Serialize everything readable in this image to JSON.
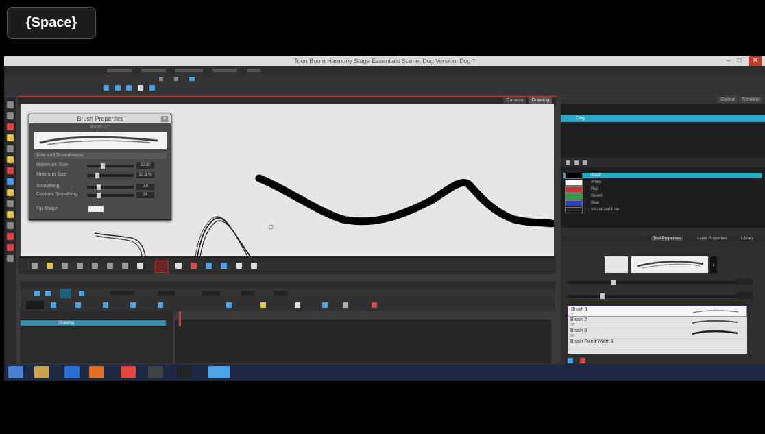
{
  "window": {
    "title": "Toon Boom Harmony Stage Essentials Scene: Dog Version: Dog *",
    "controls": {
      "minimize": "–",
      "maximize": "□",
      "close": "✕"
    }
  },
  "overlay": {
    "key_badge": "{Space}"
  },
  "brush_properties": {
    "title": "Brush Properties",
    "brush_name": "Brush 1 *",
    "section": "Size and Smoothness",
    "rows": [
      {
        "label": "Maximum Size",
        "value": "32.00"
      },
      {
        "label": "Minimum Size",
        "value": "33.3 %"
      },
      {
        "label": "Smoothing",
        "value": "0.0"
      },
      {
        "label": "Contour Smoothing",
        "value": "26"
      }
    ],
    "tip_label": "Tip Shape"
  },
  "viewport": {
    "tabs": [
      "Camera",
      "Drawing"
    ]
  },
  "timeline": {
    "layer_name": "Drawing"
  },
  "right_panel": {
    "tabs": [
      "Colour",
      "Timeline"
    ],
    "palettes": [
      "Dog"
    ],
    "colors": [
      {
        "name": "Black",
        "hex": "#000000"
      },
      {
        "name": "White",
        "hex": "#ffffff"
      },
      {
        "name": "Red",
        "hex": "#d32f2f"
      },
      {
        "name": "Green",
        "hex": "#2e9b3a"
      },
      {
        "name": "Blue",
        "hex": "#2b43c7"
      },
      {
        "name": "Vectorized Line",
        "hex": "#1e1e1e"
      }
    ],
    "tool_tabs": [
      "Tool Properties",
      "Layer Properties",
      "Library"
    ],
    "brushes": [
      {
        "name": "Brush 1",
        "size": "8"
      },
      {
        "name": "Brush 2",
        "size": "16"
      },
      {
        "name": "Brush 3",
        "size": "30"
      },
      {
        "name": "Brush Fixed Width 1",
        "size": ""
      }
    ]
  },
  "taskbar": {
    "apps": [
      "start",
      "file-explorer",
      "photoshop",
      "vlc",
      "chrome",
      "capture",
      "obs",
      "harmony"
    ]
  }
}
